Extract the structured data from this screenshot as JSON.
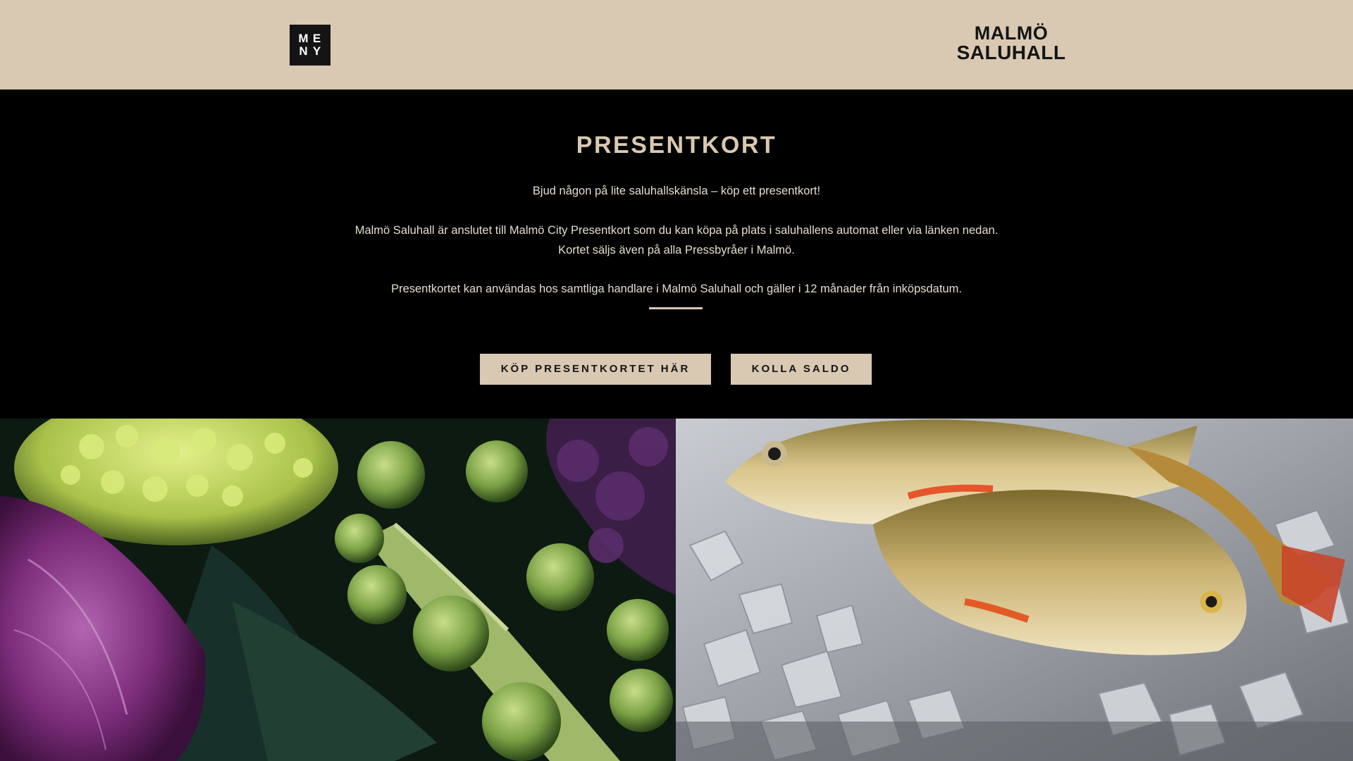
{
  "header": {
    "menu_button": {
      "line1a": "M",
      "line1b": "E",
      "line2a": "N",
      "line2b": "Y"
    },
    "logo": {
      "line1": "MALMÖ",
      "line2": "SALUHALL"
    }
  },
  "hero": {
    "title": "PRESENTKORT",
    "paragraphs": [
      "Bjud någon på lite saluhallskänsla – köp ett presentkort!",
      "Malmö Saluhall är anslutet till Malmö City Presentkort som du kan köpa på plats i saluhallens automat eller via länken nedan. Kortet säljs även på alla Pressbyråer i Malmö.",
      "Presentkortet kan användas hos samtliga handlare i Malmö Saluhall och gäller i 12 månader från inköpsdatum."
    ],
    "buttons": {
      "buy": "KÖP PRESENTKORTET HÄR",
      "balance": "KOLLA SALDO"
    }
  },
  "colors": {
    "beige": "#d9c9b2",
    "black": "#000000",
    "dark": "#141414"
  }
}
